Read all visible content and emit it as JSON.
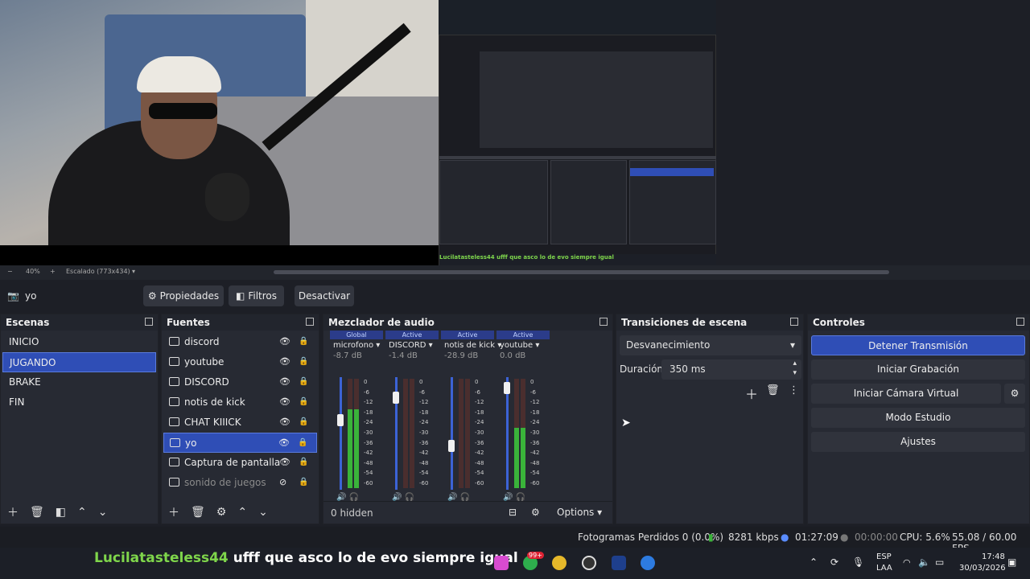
{
  "window": {
    "minimize": "─",
    "maximize": "❐",
    "close": "✕"
  },
  "preview": {
    "zoom": "40%",
    "scale_label": "Escalado (773x434)",
    "nested_chat": "Lucilatasteless44  ufff que asco lo de evo siempre igual"
  },
  "source_toolbar": {
    "selected_source": "yo",
    "properties": "Propiedades",
    "filters": "Filtros",
    "deactivate": "Desactivar"
  },
  "scenes": {
    "title": "Escenas",
    "items": [
      {
        "label": "INICIO",
        "selected": false
      },
      {
        "label": "JUGANDO",
        "selected": true
      },
      {
        "label": "BRAKE",
        "selected": false
      },
      {
        "label": "FIN",
        "selected": false
      }
    ]
  },
  "sources": {
    "title": "Fuentes",
    "items": [
      {
        "label": "discord",
        "icon": "window-capture-icon",
        "visible": true,
        "selected": false
      },
      {
        "label": "youtube",
        "icon": "audio-capture-icon",
        "visible": true,
        "selected": false
      },
      {
        "label": "DISCORD",
        "icon": "audio-capture-icon",
        "visible": true,
        "selected": false
      },
      {
        "label": "notis de kick",
        "icon": "browser-icon",
        "visible": true,
        "selected": false
      },
      {
        "label": "CHAT KIIICK",
        "icon": "browser-icon",
        "visible": true,
        "selected": false
      },
      {
        "label": "yo",
        "icon": "camera-icon",
        "visible": true,
        "selected": true
      },
      {
        "label": "Captura de pantalla",
        "icon": "monitor-icon",
        "visible": true,
        "selected": false
      },
      {
        "label": "sonido de juegos",
        "icon": "audio-capture-icon",
        "visible": false,
        "selected": false
      }
    ]
  },
  "mixer": {
    "title": "Mezclador de audio",
    "channels": [
      {
        "tag": "Global",
        "name": "microfono",
        "db": "-8.7 dB",
        "fader": 0.63,
        "level": 0.72
      },
      {
        "tag": "Active",
        "name": "DISCORD",
        "db": "-1.4 dB",
        "fader": 0.86,
        "level": 0.0
      },
      {
        "tag": "Active",
        "name": "notis de kick",
        "db": "-28.9 dB",
        "fader": 0.38,
        "level": 0.0
      },
      {
        "tag": "Active",
        "name": "youtube",
        "db": "0.0 dB",
        "fader": 0.95,
        "level": 0.55
      }
    ],
    "scale": [
      "0",
      "-6",
      "-12",
      "-18",
      "-24",
      "-30",
      "-36",
      "-42",
      "-48",
      "-54",
      "-60"
    ],
    "hidden": "0 hidden",
    "options": "Options"
  },
  "transitions": {
    "title": "Transiciones de escena",
    "selected": "Desvanecimiento",
    "duration_label": "Duración",
    "duration_value": "350 ms"
  },
  "controls": {
    "title": "Controles",
    "stop_stream": "Detener Transmisión",
    "start_recording": "Iniciar Grabación",
    "start_virtual_cam": "Iniciar Cámara Virtual",
    "studio_mode": "Modo Estudio",
    "settings": "Ajustes"
  },
  "status": {
    "dropped": "Fotogramas Perdidos 0 (0.0%)",
    "bitrate": "8281 kbps",
    "stream_time": "01:27:09",
    "rec_time": "00:00:00",
    "cpu": "CPU: 5.6%",
    "fps": "55.08 / 60.00 FPS"
  },
  "taskbar": {
    "chat_user": "Lucilatasteless44",
    "chat_msg": "ufff que asco lo de evo siempre igual",
    "badge": "99+",
    "lang1": "ESP",
    "lang2": "LAA",
    "time": "17:48",
    "date": "30/03/2026"
  },
  "colors": {
    "accent": "#2f4eb6",
    "panel": "#272a33",
    "bg": "#1d1f26",
    "chat_user": "#7fd64b"
  }
}
